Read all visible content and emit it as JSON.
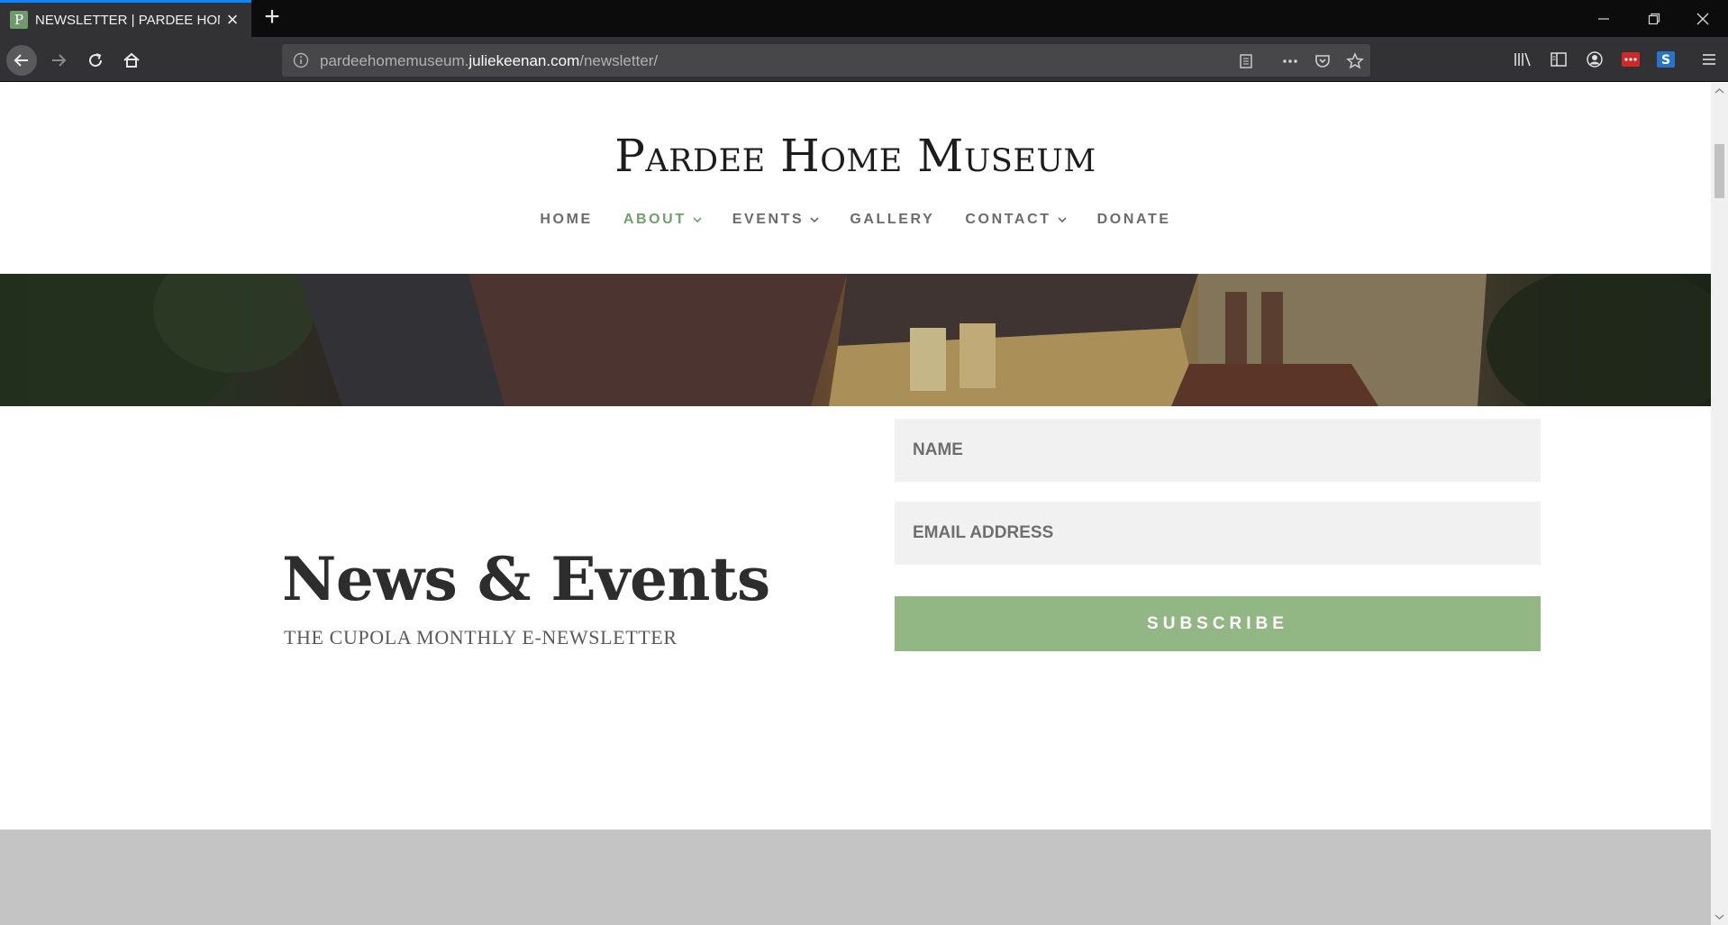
{
  "browser": {
    "tab_title": "NEWSLETTER | PARDEE HOME MUSEUM",
    "favicon_letter": "P",
    "url_prefix": "pardeehomemuseum.",
    "url_domain": "juliekeenan.com",
    "url_path": "/newsletter/"
  },
  "site": {
    "logo": "Pardee Home Museum",
    "nav": [
      {
        "label": "HOME",
        "active": false,
        "dropdown": false
      },
      {
        "label": "ABOUT",
        "active": true,
        "dropdown": true
      },
      {
        "label": "EVENTS",
        "active": false,
        "dropdown": true
      },
      {
        "label": "GALLERY",
        "active": false,
        "dropdown": false
      },
      {
        "label": "CONTACT",
        "active": false,
        "dropdown": true
      },
      {
        "label": "DONATE",
        "active": false,
        "dropdown": false
      }
    ],
    "accent_color": "#6fa26a"
  },
  "newsletter": {
    "title": "News & Events",
    "subtitle": "THE CUPOLA MONTHLY E-NEWSLETTER",
    "name_placeholder": "NAME",
    "email_placeholder": "EMAIL ADDRESS",
    "subscribe_label": "SUBSCRIBE",
    "button_color": "#93b685"
  }
}
